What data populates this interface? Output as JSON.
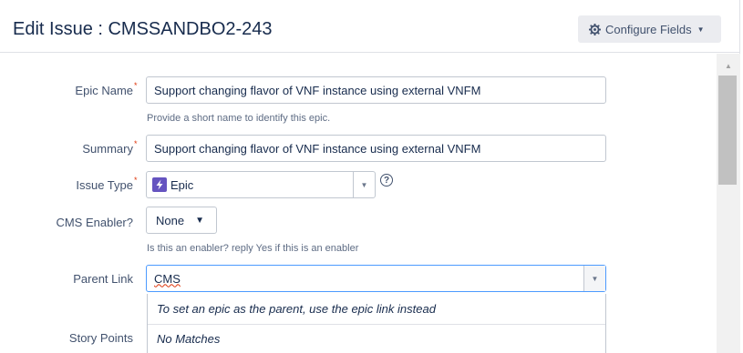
{
  "header": {
    "title": "Edit Issue : CMSSANDBO2-243",
    "configure_label": "Configure Fields"
  },
  "form": {
    "epic_name": {
      "label": "Epic Name",
      "value": "Support changing flavor of VNF instance using external VNFM",
      "hint": "Provide a short name to identify this epic."
    },
    "summary": {
      "label": "Summary",
      "value": "Support changing flavor of VNF instance using external VNFM"
    },
    "issue_type": {
      "label": "Issue Type",
      "value": "Epic"
    },
    "cms_enabler": {
      "label": "CMS Enabler?",
      "value": "None",
      "hint": "Is this an enabler? reply Yes if this is an enabler"
    },
    "parent_link": {
      "label": "Parent Link",
      "value": "CMS",
      "dropdown": [
        "To set an epic as the parent, use the epic link instead",
        "No Matches"
      ]
    },
    "story_points": {
      "label": "Story Points"
    }
  },
  "colors": {
    "epic_icon": "#6554c0",
    "required": "#de350b",
    "focus_border": "#4c9aff"
  },
  "icons": [
    "gear-icon",
    "caret-down-icon",
    "epic-icon",
    "help-icon",
    "scroll-up-icon"
  ]
}
